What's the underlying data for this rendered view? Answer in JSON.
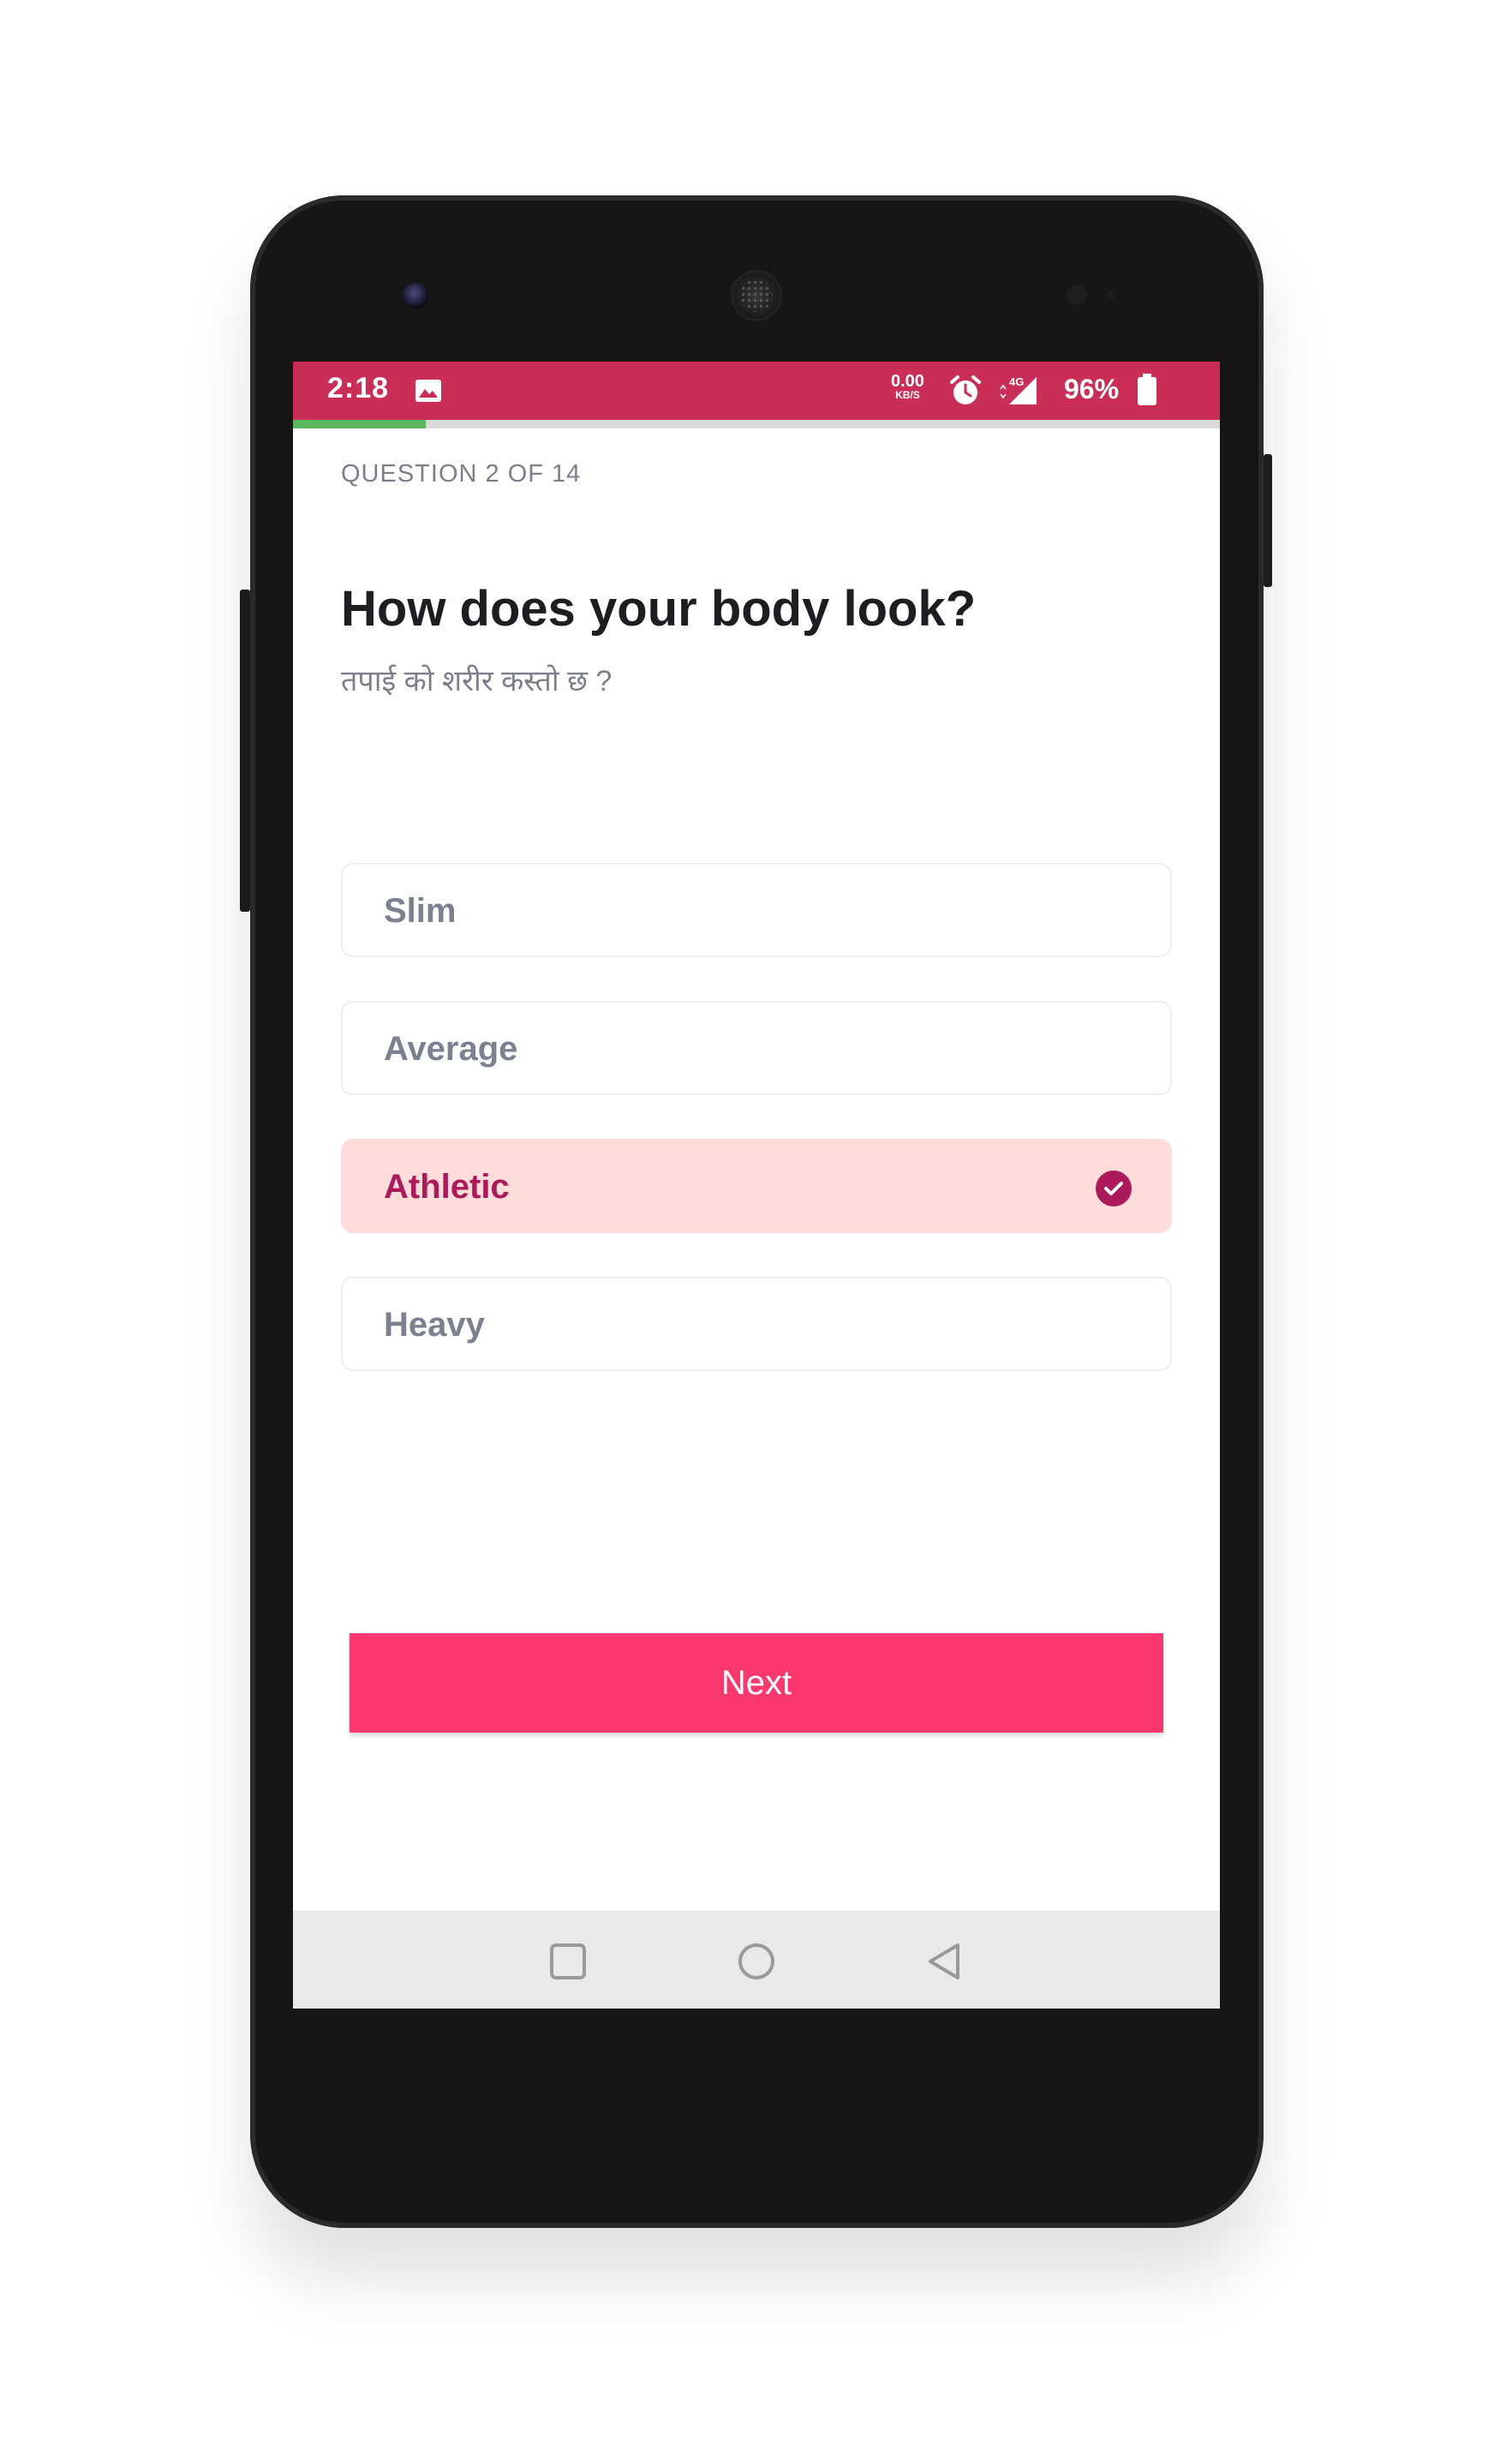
{
  "status_bar": {
    "time": "2:18",
    "net_speed_value": "0.00",
    "net_speed_unit": "KB/S",
    "network_type": "4G",
    "battery_percent": "96%",
    "bg_color": "#ca2d55"
  },
  "progress": {
    "fraction": 0.143,
    "color": "#5cb85c"
  },
  "quiz": {
    "question_count": "QUESTION 2 OF 14",
    "title": "How does your body look?",
    "subtitle": "तपाई को शरीर कस्तो छ ?",
    "options": [
      {
        "label": "Slim",
        "selected": false
      },
      {
        "label": "Average",
        "selected": false
      },
      {
        "label": "Athletic",
        "selected": true
      },
      {
        "label": "Heavy",
        "selected": false
      }
    ],
    "selected_color": "#ad1a5c",
    "selected_bg": "#fddcda"
  },
  "actions": {
    "next_label": "Next",
    "next_color": "#fb386e"
  },
  "nav_bar": {
    "icons": [
      "recents-icon",
      "home-icon",
      "back-icon"
    ]
  }
}
